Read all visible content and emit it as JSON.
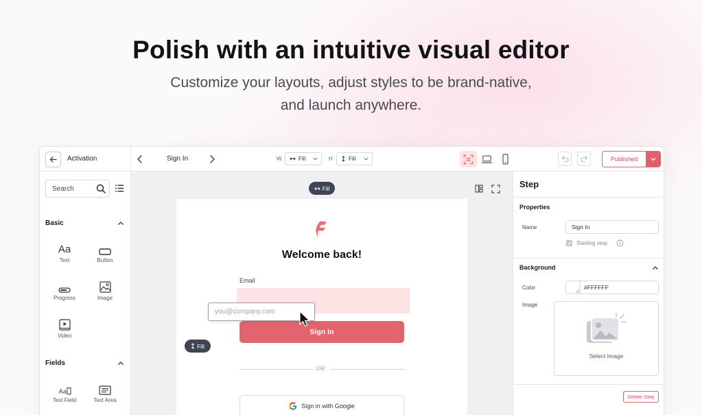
{
  "hero": {
    "title": "Polish with an intuitive visual editor",
    "subtitle_line1": "Customize your layouts, adjust styles to be brand-native,",
    "subtitle_line2": "and launch anywhere."
  },
  "topbar": {
    "title": "Activation",
    "step_name": "Sign In",
    "width_label": "W",
    "width_value": "Fill",
    "height_label": "H",
    "height_value": "Fill",
    "publish_label": "Published"
  },
  "sidebar": {
    "search_placeholder": "Search",
    "sections": [
      {
        "title": "Basic",
        "items": [
          "Text",
          "Button",
          "Progress",
          "Image",
          "Video"
        ]
      },
      {
        "title": "Fields",
        "items": [
          "Text Field",
          "Text Area"
        ]
      }
    ],
    "text_glyph": "Aa"
  },
  "canvas": {
    "fill_top": "Fill",
    "fill_left": "Fill",
    "welcome": "Welcome back!",
    "email_label": "Email",
    "email_placeholder": "you@company.com",
    "signin_label": "Sign In",
    "or_label": "OR",
    "google_label": "Sign in with Google"
  },
  "panel": {
    "title": "Step",
    "properties_title": "Properties",
    "name_label": "Name",
    "name_value": "Sign In",
    "starting_step_label": "Starting step",
    "background_title": "Background",
    "color_label": "Color",
    "color_value": "#FFFFFF",
    "image_label": "Image",
    "select_image_label": "Select Image",
    "delete_label": "Delete Step"
  },
  "colors": {
    "accent": "#e2646e",
    "accent_light": "#fde3e3",
    "pill_dark": "#3e4656"
  }
}
